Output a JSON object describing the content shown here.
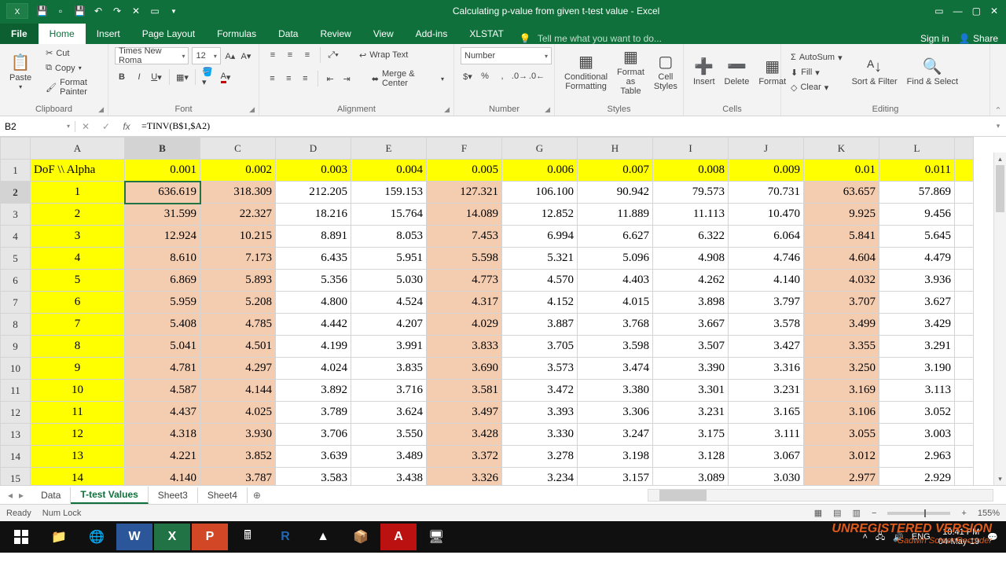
{
  "title": "Calculating p-value from given t-test value - Excel",
  "signin": "Sign in",
  "share": "Share",
  "tabs": {
    "file": "File",
    "home": "Home",
    "insert": "Insert",
    "page": "Page Layout",
    "formulas": "Formulas",
    "data": "Data",
    "review": "Review",
    "view": "View",
    "addins": "Add-ins",
    "xlstat": "XLSTAT",
    "tell": "Tell me what you want to do..."
  },
  "clipboard": {
    "paste": "Paste",
    "cut": "Cut",
    "copy": "Copy",
    "fmt": "Format Painter",
    "label": "Clipboard"
  },
  "font": {
    "name": "Times New Roma",
    "size": "12",
    "label": "Font"
  },
  "align": {
    "wrap": "Wrap Text",
    "merge": "Merge & Center",
    "label": "Alignment"
  },
  "number": {
    "fmt": "Number",
    "label": "Number"
  },
  "styles": {
    "cf": "Conditional Formatting",
    "fat": "Format as Table",
    "cs": "Cell Styles",
    "label": "Styles"
  },
  "cells": {
    "ins": "Insert",
    "del": "Delete",
    "fmt": "Format",
    "label": "Cells"
  },
  "editing": {
    "sum": "AutoSum",
    "fill": "Fill",
    "clear": "Clear",
    "sort": "Sort & Filter",
    "find": "Find & Select",
    "label": "Editing"
  },
  "nameBox": "B2",
  "formula": "=TINV(B$1,$A2)",
  "cols": [
    "A",
    "B",
    "C",
    "D",
    "E",
    "F",
    "G",
    "H",
    "I",
    "J",
    "K",
    "L"
  ],
  "rowNums": [
    "1",
    "2",
    "3",
    "4",
    "5",
    "6",
    "7",
    "8",
    "9",
    "10",
    "11",
    "12",
    "13",
    "14",
    "15"
  ],
  "chart_data": {
    "type": "table",
    "corner": "DoF \\\\ Alpha",
    "alpha": [
      "0.001",
      "0.002",
      "0.003",
      "0.004",
      "0.005",
      "0.006",
      "0.007",
      "0.008",
      "0.009",
      "0.01",
      "0.011"
    ],
    "dof": [
      "1",
      "2",
      "3",
      "4",
      "5",
      "6",
      "7",
      "8",
      "9",
      "10",
      "11",
      "12",
      "13",
      "14"
    ],
    "values": [
      [
        "636.619",
        "318.309",
        "212.205",
        "159.153",
        "127.321",
        "106.100",
        "90.942",
        "79.573",
        "70.731",
        "63.657",
        "57.869"
      ],
      [
        "31.599",
        "22.327",
        "18.216",
        "15.764",
        "14.089",
        "12.852",
        "11.889",
        "11.113",
        "10.470",
        "9.925",
        "9.456"
      ],
      [
        "12.924",
        "10.215",
        "8.891",
        "8.053",
        "7.453",
        "6.994",
        "6.627",
        "6.322",
        "6.064",
        "5.841",
        "5.645"
      ],
      [
        "8.610",
        "7.173",
        "6.435",
        "5.951",
        "5.598",
        "5.321",
        "5.096",
        "4.908",
        "4.746",
        "4.604",
        "4.479"
      ],
      [
        "6.869",
        "5.893",
        "5.356",
        "5.030",
        "4.773",
        "4.570",
        "4.403",
        "4.262",
        "4.140",
        "4.032",
        "3.936"
      ],
      [
        "5.959",
        "5.208",
        "4.800",
        "4.524",
        "4.317",
        "4.152",
        "4.015",
        "3.898",
        "3.797",
        "3.707",
        "3.627"
      ],
      [
        "5.408",
        "4.785",
        "4.442",
        "4.207",
        "4.029",
        "3.887",
        "3.768",
        "3.667",
        "3.578",
        "3.499",
        "3.429"
      ],
      [
        "5.041",
        "4.501",
        "4.199",
        "3.991",
        "3.833",
        "3.705",
        "3.598",
        "3.507",
        "3.427",
        "3.355",
        "3.291"
      ],
      [
        "4.781",
        "4.297",
        "4.024",
        "3.835",
        "3.690",
        "3.573",
        "3.474",
        "3.390",
        "3.316",
        "3.250",
        "3.190"
      ],
      [
        "4.587",
        "4.144",
        "3.892",
        "3.716",
        "3.581",
        "3.472",
        "3.380",
        "3.301",
        "3.231",
        "3.169",
        "3.113"
      ],
      [
        "4.437",
        "4.025",
        "3.789",
        "3.624",
        "3.497",
        "3.393",
        "3.306",
        "3.231",
        "3.165",
        "3.106",
        "3.052"
      ],
      [
        "4.318",
        "3.930",
        "3.706",
        "3.550",
        "3.428",
        "3.330",
        "3.247",
        "3.175",
        "3.111",
        "3.055",
        "3.003"
      ],
      [
        "4.221",
        "3.852",
        "3.639",
        "3.489",
        "3.372",
        "3.278",
        "3.198",
        "3.128",
        "3.067",
        "3.012",
        "2.963"
      ],
      [
        "4.140",
        "3.787",
        "3.583",
        "3.438",
        "3.326",
        "3.234",
        "3.157",
        "3.089",
        "3.030",
        "2.977",
        "2.929"
      ]
    ],
    "shadedCols": [
      0,
      1,
      4,
      9
    ]
  },
  "sheets": {
    "s1": "Data",
    "s2": "T-test Values",
    "s3": "Sheet3",
    "s4": "Sheet4"
  },
  "status": {
    "ready": "Ready",
    "num": "Num Lock",
    "zoom": "155%"
  },
  "watermark": {
    "l1": "UNREGISTERED VERSION",
    "l2": "Gadwin ScreenRecorder"
  },
  "tray": {
    "time": "10:41 PM",
    "date": "04-May-19",
    "lang": "ENG"
  }
}
